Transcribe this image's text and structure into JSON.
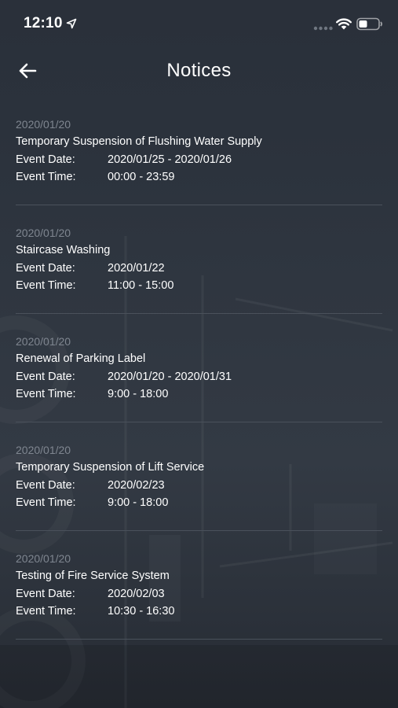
{
  "status_bar": {
    "time": "12:10"
  },
  "header": {
    "title": "Notices"
  },
  "labels": {
    "event_date": "Event Date:",
    "event_time": "Event Time:"
  },
  "notices": [
    {
      "posted": "2020/01/20",
      "title": "Temporary Suspension of Flushing Water Supply",
      "event_date": "2020/01/25 - 2020/01/26",
      "event_time": "00:00 - 23:59"
    },
    {
      "posted": "2020/01/20",
      "title": "Staircase Washing",
      "event_date": "2020/01/22",
      "event_time": "11:00 - 15:00"
    },
    {
      "posted": "2020/01/20",
      "title": "Renewal of Parking Label",
      "event_date": "2020/01/20 - 2020/01/31",
      "event_time": "9:00 - 18:00"
    },
    {
      "posted": "2020/01/20",
      "title": "Temporary Suspension of Lift Service",
      "event_date": "2020/02/23",
      "event_time": "9:00 - 18:00"
    },
    {
      "posted": "2020/01/20",
      "title": "Testing of Fire Service System",
      "event_date": "2020/02/03",
      "event_time": "10:30 - 16:30"
    }
  ],
  "icons": {
    "location": "location-arrow-icon",
    "signal": "cellular-signal-icon",
    "wifi": "wifi-icon",
    "battery": "battery-icon",
    "back": "back-arrow-icon"
  },
  "colors": {
    "background": "#2f3640",
    "text_primary": "#ffffff",
    "text_muted": "#7f8690",
    "divider": "#4a515b"
  }
}
